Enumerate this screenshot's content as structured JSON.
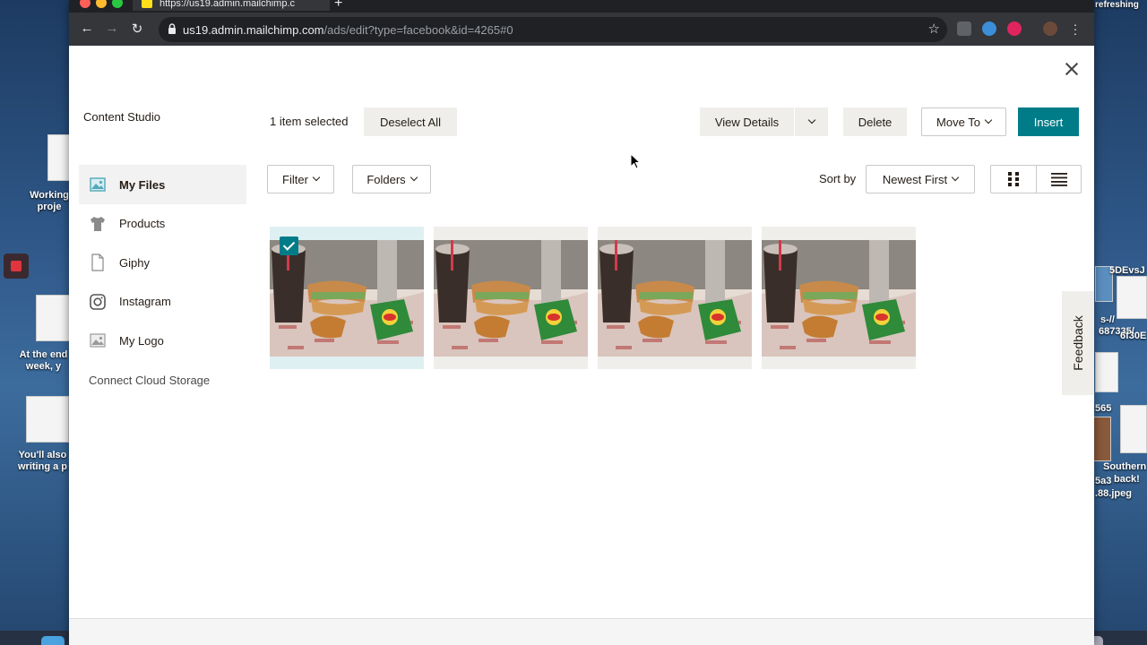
{
  "desktop": {
    "notes": [
      {
        "lines": [
          "Working",
          "proje"
        ]
      },
      {
        "lines": [
          "At the end",
          "week, y"
        ]
      },
      {
        "lines": [
          "You'll also",
          "writing a p"
        ]
      }
    ],
    "right_labels": [
      "refreshing",
      "5DEvsJ",
      "s-//",
      "687335/",
      "6f30E",
      "565",
      "Southern",
      "back!",
      "5a3",
      ".88.jpeg"
    ]
  },
  "browser": {
    "tab_title": "https://us19.admin.mailchimp.c",
    "url_host": "us19.admin.mailchimp.com",
    "url_path": "/ads/edit?type=facebook&id=4265#0"
  },
  "studio": {
    "title": "Content Studio",
    "sidebar": [
      {
        "label": "My Files",
        "icon": "image-icon",
        "active": true
      },
      {
        "label": "Products",
        "icon": "tshirt-icon",
        "active": false
      },
      {
        "label": "Giphy",
        "icon": "file-icon",
        "active": false
      },
      {
        "label": "Instagram",
        "icon": "instagram-icon",
        "active": false
      },
      {
        "label": "My Logo",
        "icon": "image-icon",
        "active": false
      }
    ],
    "connect_label": "Connect Cloud Storage",
    "selection_text": "1 item selected",
    "deselect_label": "Deselect All",
    "view_details_label": "View Details",
    "delete_label": "Delete",
    "move_to_label": "Move To",
    "insert_label": "Insert",
    "filter_label": "Filter",
    "folders_label": "Folders",
    "sort_label": "Sort by",
    "sort_value": "Newest First",
    "files": [
      {
        "selected": true
      },
      {
        "selected": false
      },
      {
        "selected": false
      },
      {
        "selected": false
      }
    ],
    "feedback_label": "Feedback",
    "colors": {
      "accent": "#007c89",
      "button_gray": "#efeeea",
      "selected_card": "#dff0f2"
    }
  }
}
